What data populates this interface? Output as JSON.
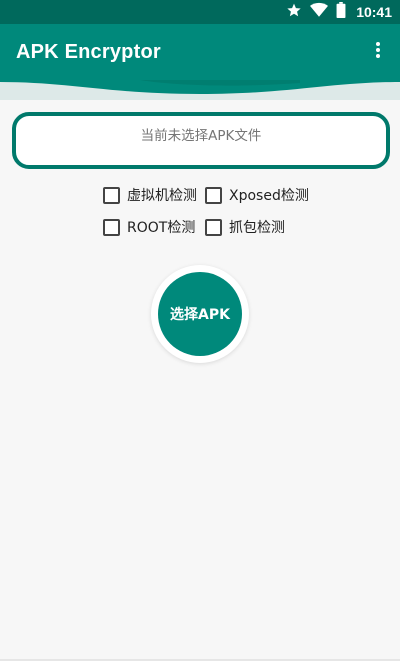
{
  "status_bar": {
    "time": "10:41",
    "icons": [
      "star-icon",
      "wifi-icon",
      "battery-icon"
    ]
  },
  "app_bar": {
    "title": "APK Encryptor",
    "menu_icon": "more-vert-icon"
  },
  "file_box": {
    "text": "当前未选择APK文件"
  },
  "options": [
    {
      "label": "虚拟机检测",
      "checked": false
    },
    {
      "label": "Xposed检测",
      "checked": false
    },
    {
      "label": "ROOT检测",
      "checked": false
    },
    {
      "label": "抓包检测",
      "checked": false
    }
  ],
  "select_button": {
    "label": "选择APK"
  },
  "colors": {
    "status_bar": "#00695c",
    "primary": "#00897b",
    "border": "#00796b",
    "background": "#f7f7f7"
  }
}
